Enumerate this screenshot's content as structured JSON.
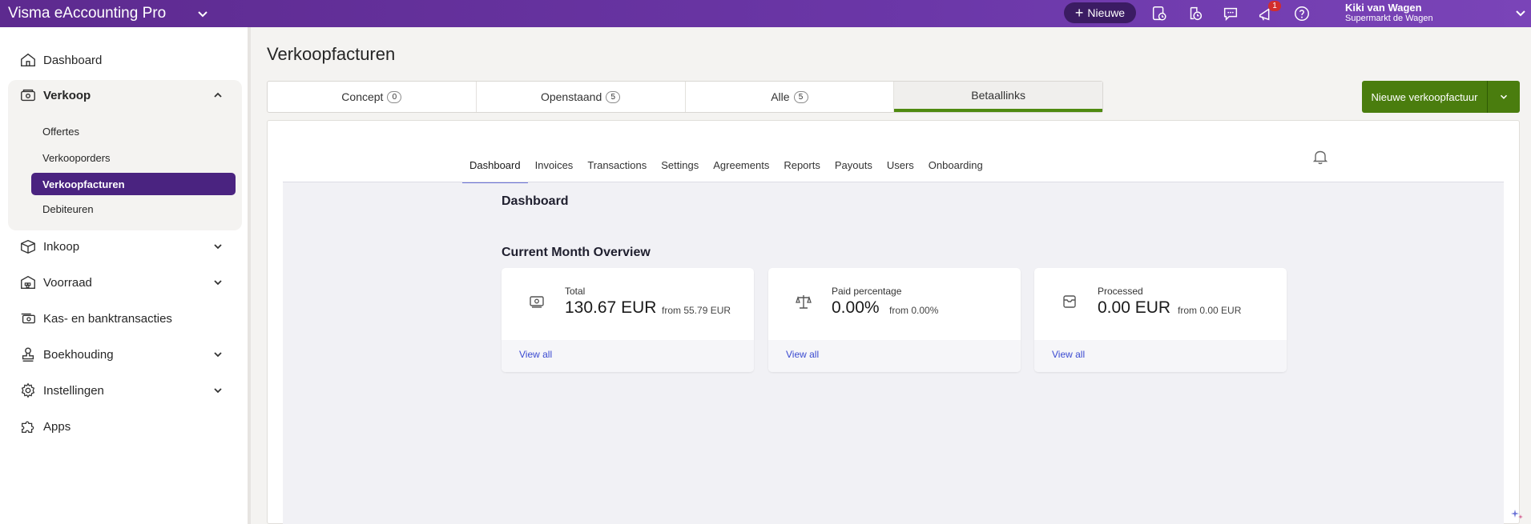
{
  "topbar": {
    "app_title": "Visma eAccounting Pro",
    "new_button": "Nieuwe",
    "notification_count": "1",
    "user_name": "Kiki van Wagen",
    "user_company": "Supermarkt de Wagen"
  },
  "sidebar": {
    "dashboard": "Dashboard",
    "verkoop": "Verkoop",
    "verkoop_items": [
      "Offertes",
      "Verkooporders",
      "Verkoopfacturen",
      "Debiteuren"
    ],
    "inkoop": "Inkoop",
    "voorraad": "Voorraad",
    "kas": "Kas- en banktransacties",
    "boekhouding": "Boekhouding",
    "instellingen": "Instellingen",
    "apps": "Apps"
  },
  "main": {
    "page_title": "Verkoopfacturen",
    "status_tabs": [
      {
        "label": "Concept",
        "count": "0"
      },
      {
        "label": "Openstaand",
        "count": "5"
      },
      {
        "label": "Alle",
        "count": "5"
      },
      {
        "label": "Betaallinks",
        "count": ""
      }
    ],
    "primary_button": "Nieuwe verkoopfactuur",
    "subnav": [
      "Dashboard",
      "Invoices",
      "Transactions",
      "Settings",
      "Agreements",
      "Reports",
      "Payouts",
      "Users",
      "Onboarding"
    ],
    "dashboard_title": "Dashboard",
    "overview_title": "Current Month Overview",
    "metrics": [
      {
        "label": "Total",
        "value": "130.67 EUR",
        "from": "from 55.79 EUR",
        "link": "View all"
      },
      {
        "label": "Paid percentage",
        "value": "0.00%",
        "from": "from 0.00%",
        "link": "View all"
      },
      {
        "label": "Processed",
        "value": "0.00 EUR",
        "from": "from 0.00 EUR",
        "link": "View all"
      }
    ]
  },
  "colors": {
    "topbar": "#5d2a8f",
    "active_nav": "#4a2380",
    "primary_button": "#4a7d0e",
    "active_tab_underline": "#4f8a10",
    "link": "#3a4ad0"
  }
}
